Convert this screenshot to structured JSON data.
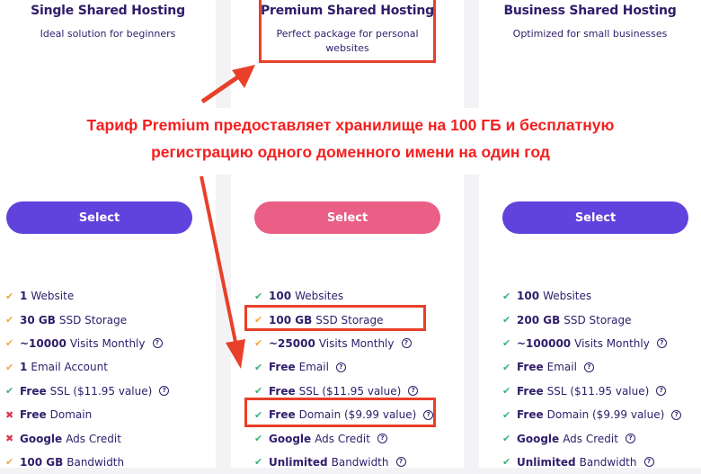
{
  "plans": [
    {
      "title": "Single Shared Hosting",
      "description": "Ideal solution for beginners",
      "button_label": "Select",
      "button_color": "#5f43dc",
      "features": [
        {
          "icon": "check-icon",
          "status": "warn",
          "bold": "1",
          "text": "Website",
          "help": false
        },
        {
          "icon": "check-icon",
          "status": "warn",
          "bold": "30 GB",
          "text": "SSD Storage",
          "help": false
        },
        {
          "icon": "check-icon",
          "status": "warn",
          "bold": "~10000",
          "text": "Visits Monthly",
          "help": true
        },
        {
          "icon": "check-icon",
          "status": "warn",
          "bold": "1",
          "text": "Email Account",
          "help": false
        },
        {
          "icon": "check-icon",
          "status": "ok",
          "bold": "Free",
          "text": "SSL ($11.95 value)",
          "help": true
        },
        {
          "icon": "cross-icon",
          "status": "no",
          "bold": "Free",
          "text": "Domain",
          "help": false
        },
        {
          "icon": "cross-icon",
          "status": "no",
          "bold": "Google",
          "text": "Ads Credit",
          "help": false
        },
        {
          "icon": "check-icon",
          "status": "warn",
          "bold": "100 GB",
          "text": "Bandwidth",
          "help": false
        }
      ]
    },
    {
      "title": "Premium Shared Hosting",
      "description": "Perfect package for personal websites",
      "button_label": "Select",
      "button_color": "#e95f86",
      "features": [
        {
          "icon": "check-icon",
          "status": "ok",
          "bold": "100",
          "text": "Websites",
          "help": false
        },
        {
          "icon": "check-icon",
          "status": "warn",
          "bold": "100 GB",
          "text": "SSD Storage",
          "help": false
        },
        {
          "icon": "check-icon",
          "status": "warn",
          "bold": "~25000",
          "text": "Visits Monthly",
          "help": true
        },
        {
          "icon": "check-icon",
          "status": "ok",
          "bold": "Free",
          "text": "Email",
          "help": true
        },
        {
          "icon": "check-icon",
          "status": "ok",
          "bold": "Free",
          "text": "SSL ($11.95 value)",
          "help": true
        },
        {
          "icon": "check-icon",
          "status": "ok",
          "bold": "Free",
          "text": "Domain ($9.99 value)",
          "help": true
        },
        {
          "icon": "check-icon",
          "status": "ok",
          "bold": "Google",
          "text": "Ads Credit",
          "help": true
        },
        {
          "icon": "check-icon",
          "status": "ok",
          "bold": "Unlimited",
          "text": "Bandwidth",
          "help": true
        }
      ]
    },
    {
      "title": "Business Shared Hosting",
      "description": "Optimized for small businesses",
      "button_label": "Select",
      "button_color": "#5f43dc",
      "features": [
        {
          "icon": "check-icon",
          "status": "ok",
          "bold": "100",
          "text": "Websites",
          "help": false
        },
        {
          "icon": "check-icon",
          "status": "ok",
          "bold": "200 GB",
          "text": "SSD Storage",
          "help": false
        },
        {
          "icon": "check-icon",
          "status": "ok",
          "bold": "~100000",
          "text": "Visits Monthly",
          "help": true
        },
        {
          "icon": "check-icon",
          "status": "ok",
          "bold": "Free",
          "text": "Email",
          "help": true
        },
        {
          "icon": "check-icon",
          "status": "ok",
          "bold": "Free",
          "text": "SSL ($11.95 value)",
          "help": true
        },
        {
          "icon": "check-icon",
          "status": "ok",
          "bold": "Free",
          "text": "Domain ($9.99 value)",
          "help": true
        },
        {
          "icon": "check-icon",
          "status": "ok",
          "bold": "Google",
          "text": "Ads Credit",
          "help": true
        },
        {
          "icon": "check-icon",
          "status": "ok",
          "bold": "Unlimited",
          "text": "Bandwidth",
          "help": true
        }
      ]
    }
  ],
  "annotation": {
    "line1": "Тариф Premium предоставляет хранилище на 100 ГБ и бесплатную",
    "line2": "регистрацию одного доменного имени на один год",
    "color": "#f41f1f"
  },
  "highlight_color": "#e8402a",
  "icons": {
    "check": "✔",
    "cross": "✖",
    "help": "?"
  }
}
